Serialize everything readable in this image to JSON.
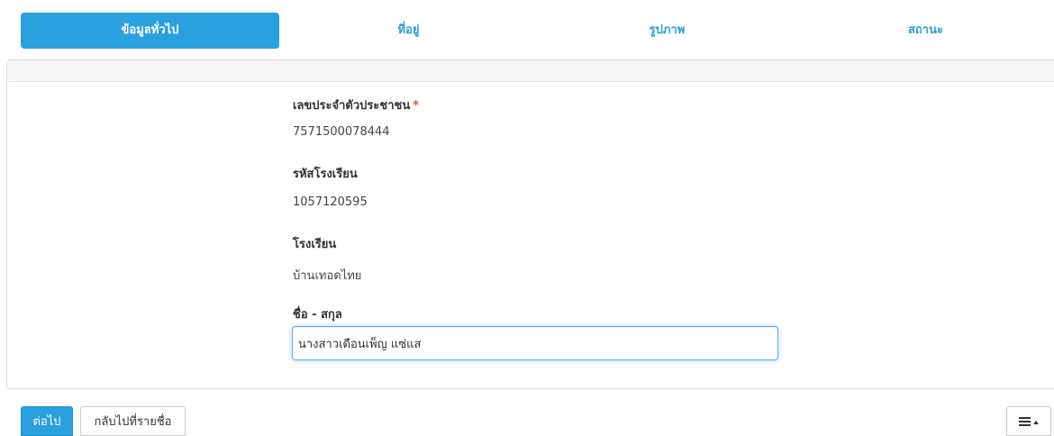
{
  "tabs": [
    {
      "label": "ข้อมูลทั่วไป",
      "active": true
    },
    {
      "label": "ที่อยู่",
      "active": false
    },
    {
      "label": "รูปภาพ",
      "active": false
    },
    {
      "label": "สถานะ",
      "active": false
    }
  ],
  "form": {
    "citizen_id": {
      "label": "เลขประจำตัวประชาชน",
      "required_mark": "*",
      "value": "7571500078444"
    },
    "school_code": {
      "label": "รหัสโรงเรียน",
      "value": "1057120595"
    },
    "school": {
      "label": "โรงเรียน",
      "value": "บ้านเทอดไทย"
    },
    "full_name": {
      "label": "ชื่อ - สกุล",
      "value": "นางสาวเดือนเพ็ญ แซ่แส"
    }
  },
  "footer": {
    "next_label": "ต่อไป",
    "back_label": "กลับไปที่รายชื่อ",
    "menu_icon": "hamburger-menu-icon",
    "caret_icon": "caret-up-icon"
  },
  "colors": {
    "accent": "#2aa0de",
    "required": "#e74c3c"
  }
}
